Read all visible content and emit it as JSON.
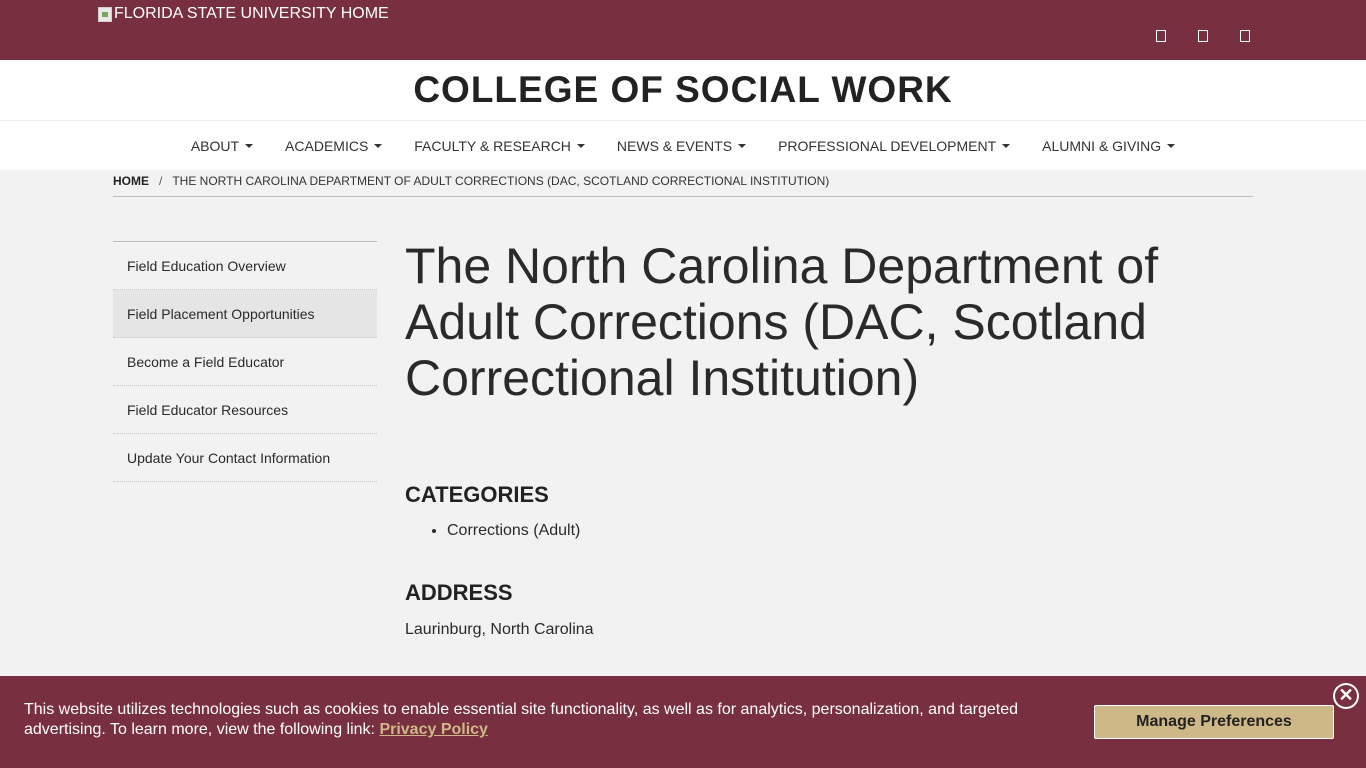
{
  "header": {
    "university_home_alt": "FLORIDA STATE UNIVERSITY HOME",
    "icons": [
      "search-icon",
      "calendar-icon",
      "menu-icon"
    ],
    "brand_color": "#782f40"
  },
  "college": {
    "title": "COLLEGE OF SOCIAL WORK"
  },
  "nav": {
    "items": [
      {
        "label": "ABOUT"
      },
      {
        "label": "ACADEMICS"
      },
      {
        "label": "FACULTY & RESEARCH"
      },
      {
        "label": "NEWS & EVENTS"
      },
      {
        "label": "PROFESSIONAL DEVELOPMENT"
      },
      {
        "label": "ALUMNI & GIVING"
      }
    ]
  },
  "breadcrumb": {
    "home": "HOME",
    "separator": "/",
    "current": "THE NORTH CAROLINA DEPARTMENT OF ADULT CORRECTIONS (DAC, SCOTLAND CORRECTIONAL INSTITUTION)"
  },
  "sidebar": {
    "items": [
      {
        "label": "Field Education Overview",
        "active": false
      },
      {
        "label": "Field Placement Opportunities",
        "active": true
      },
      {
        "label": "Become a Field Educator",
        "active": false
      },
      {
        "label": "Field Educator Resources",
        "active": false
      },
      {
        "label": "Update Your Contact Information",
        "active": false
      }
    ]
  },
  "main": {
    "title": "The North Carolina Department of Adult Corrections (DAC, Scotland Correctional Institution)",
    "categories_heading": "CATEGORIES",
    "categories": [
      "Corrections (Adult)"
    ],
    "address_heading": "ADDRESS",
    "address": "Laurinburg, North Carolina"
  },
  "cookie_banner": {
    "text": "This website utilizes technologies such as cookies to enable essential site functionality, as well as for analytics, personalization, and targeted advertising. To learn more, view the following link:",
    "link_label": "Privacy Policy",
    "button_label": "Manage Preferences",
    "close_glyph": "✕",
    "accent_color": "#ceb888"
  }
}
